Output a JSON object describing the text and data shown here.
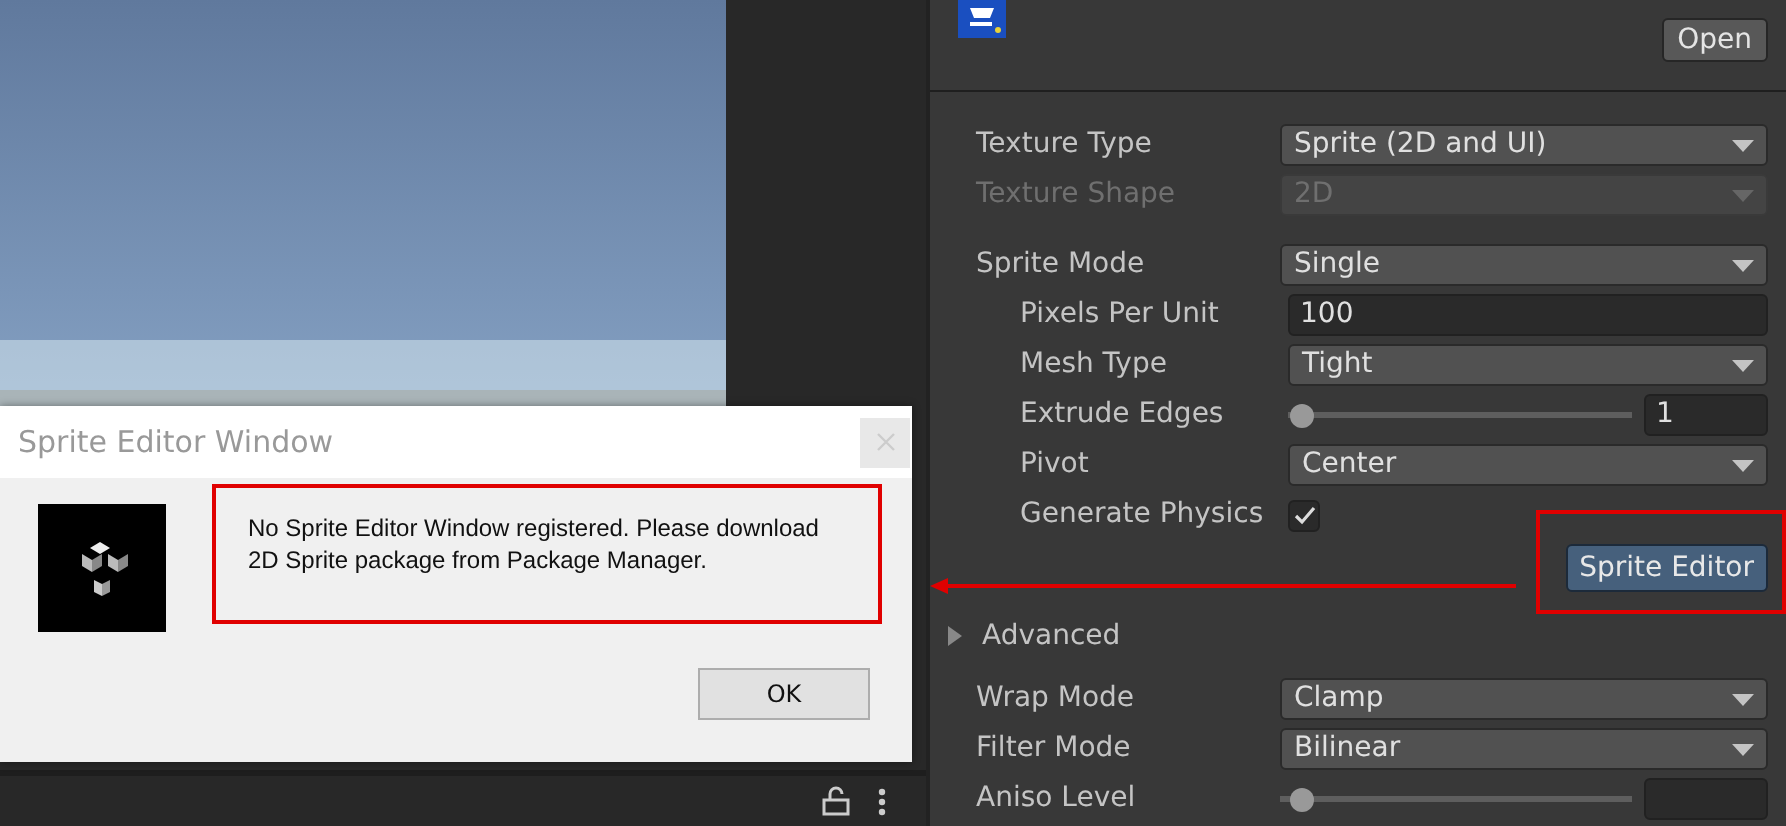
{
  "dialog": {
    "title": "Sprite Editor Window",
    "message": "No Sprite Editor Window registered. Please download 2D Sprite package from Package Manager.",
    "button": "OK"
  },
  "inspector": {
    "open_button": "Open",
    "sections": [
      [
        {
          "kind": "dropdown",
          "label": "Texture Type",
          "value": "Sprite (2D and UI)",
          "disabled": false
        },
        {
          "kind": "dropdown",
          "label": "Texture Shape",
          "value": "2D",
          "disabled": true
        }
      ],
      [
        {
          "kind": "dropdown",
          "label": "Sprite Mode",
          "value": "Single",
          "disabled": false,
          "children": [
            {
              "kind": "text",
              "label": "Pixels Per Unit",
              "value": "100"
            },
            {
              "kind": "dropdown",
              "label": "Mesh Type",
              "value": "Tight",
              "disabled": false
            },
            {
              "kind": "slider",
              "label": "Extrude Edges",
              "value": "1",
              "level": 0.04
            },
            {
              "kind": "dropdown",
              "label": "Pivot",
              "value": "Center",
              "disabled": false
            },
            {
              "kind": "checkbox",
              "label": "Generate Physics",
              "checked": true
            }
          ]
        }
      ]
    ],
    "sprite_editor_button": "Sprite Editor",
    "advanced": {
      "label": "Advanced",
      "expanded": false
    },
    "sections2": [
      {
        "kind": "dropdown",
        "label": "Wrap Mode",
        "value": "Clamp",
        "disabled": false
      },
      {
        "kind": "dropdown",
        "label": "Filter Mode",
        "value": "Bilinear",
        "disabled": false
      },
      {
        "kind": "slider",
        "label": "Aniso Level",
        "level": 0.06
      }
    ]
  }
}
